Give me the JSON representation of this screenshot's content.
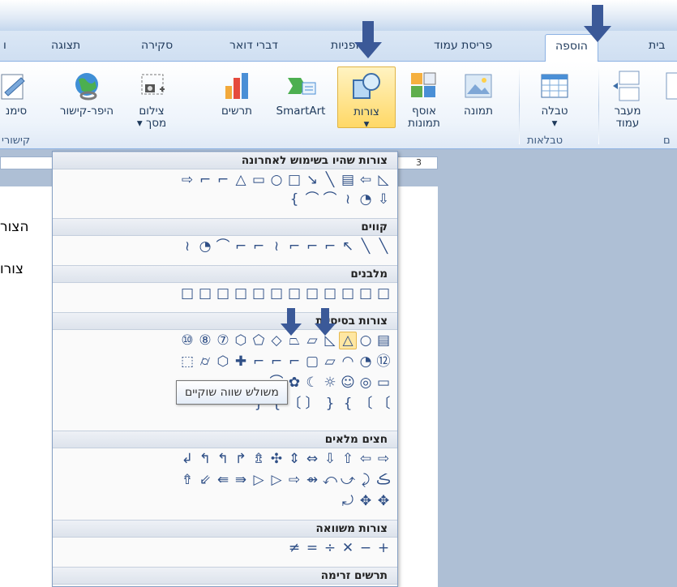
{
  "tabs": [
    {
      "label": "ת",
      "x": "r"
    },
    {
      "label": "תצוגה"
    },
    {
      "label": "סקירה"
    },
    {
      "label": "דברי דואר"
    },
    {
      "label": "הפניות"
    },
    {
      "label": "פריסת עמוד"
    },
    {
      "label": "הוספה"
    },
    {
      "label": "בית"
    }
  ],
  "ribbon": {
    "buttons": {
      "signature": "סימנ",
      "hyperlink": "היפר-קישור",
      "screenshot": "צילום",
      "screenshot_sub": "מסך",
      "chart": "תרשים",
      "smartart": "SmartArt",
      "shapes": "צורות",
      "clipart": "אוסף",
      "clipart_sub": "תמונות",
      "picture": "תמונה",
      "table": "טבלה",
      "pagebreak": "מעבר",
      "pagebreak_sub": "עמוד"
    },
    "groups": {
      "links": "קישורי",
      "tables": "טבלאות",
      "pages": "ם"
    }
  },
  "ruler_number": "3",
  "document": {
    "line1": "הצור",
    "line2": "צורו"
  },
  "shapes_gallery": {
    "sections": {
      "recent": "צורות שהיו בשימוש לאחרונה",
      "lines": "קווים",
      "rectangles": "מלבנים",
      "basic": "צורות בסיסיות",
      "block_arrows": "חצים מלאים",
      "equation": "צורות משוואה",
      "flowchart": "תרשים זרימה"
    },
    "tooltip": "משולש שווה שוקיים",
    "rows": {
      "recent1": [
        "◺",
        "⇦",
        "▤",
        "╲",
        "↘",
        "□",
        "○",
        "▭",
        "△",
        "⌐",
        "⌐",
        "⇨"
      ],
      "recent2": [
        "⇩",
        "◔",
        "≀",
        "⌒",
        "⌒",
        "{"
      ],
      "lines1": [
        "╲",
        "╲",
        "↖",
        "⌐",
        "⌐",
        "⌐",
        "≀",
        "⌐",
        "⌐",
        "⌒",
        "◔",
        "≀"
      ],
      "rects": [
        "□",
        "□",
        "□",
        "□",
        "□",
        "□",
        "□",
        "□",
        "□",
        "□",
        "□",
        "□"
      ],
      "basic1": [
        "▤",
        "○",
        "△",
        "◺",
        "▱",
        "⏢",
        "◇",
        "⬠",
        "⬡",
        "⑦",
        "⑧",
        "⑩"
      ],
      "basic2": [
        "⑫",
        "◔",
        "◠",
        "▱",
        "▢",
        "⌐",
        "⌐",
        "⌐",
        "✚",
        "⬡",
        "⌭",
        "⬚"
      ],
      "basic3": [
        "▭",
        "◎",
        "☺",
        "☼",
        "☾",
        "✿",
        "⌒"
      ],
      "basic4": [
        "〔",
        "〔",
        "{",
        "}",
        "〕",
        "〔",
        "{",
        "}"
      ],
      "arrows1": [
        "⇨",
        "⇦",
        "⇧",
        "⇩",
        "⇔",
        "⇕",
        "✣",
        "⇯",
        "↱",
        "↰",
        "↰",
        "↲"
      ],
      "arrows2": [
        "ڪ",
        "⤸",
        "⤻",
        "⤺",
        "⇴",
        "⇨",
        "▷",
        "▷",
        "⇛",
        "⇚",
        "⇙",
        "⇮"
      ],
      "arrows3": [
        "✥",
        "✥",
        "⤾"
      ],
      "equation1": [
        "+",
        "−",
        "✕",
        "÷",
        "=",
        "≠"
      ]
    }
  },
  "colors": {
    "accent": "#2b5797",
    "highlight": "#ffd866",
    "tab_border": "#8db2e3"
  }
}
